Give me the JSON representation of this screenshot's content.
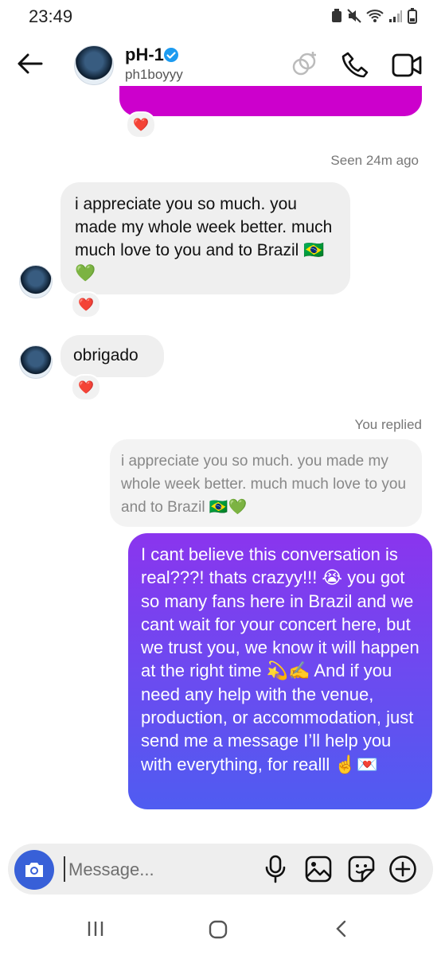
{
  "status_bar": {
    "time": "23:49"
  },
  "header": {
    "name": "pH-1",
    "handle": "ph1boyyy"
  },
  "thread": {
    "seen_label": "Seen 24m ago",
    "reaction_emoji": "❤️",
    "incoming": [
      {
        "text": "i appreciate you so much. you made my whole week better. much much love to you and to Brazil 🇧🇷💚",
        "reaction": "❤️"
      },
      {
        "text": "obrigado",
        "reaction": "❤️"
      }
    ],
    "replied_label": "You replied",
    "quoted_text": "i appreciate you so much. you made my whole week better. much much love to you and to Brazil 🇧🇷💚",
    "outgoing_text": "I cant believe this conversation is real???! thats crazyy!!! 😭 you got so many fans here in Brazil and we cant wait for your concert here, but we trust you, we know it will happen at the right time 💫✍️ And if you need any help with the venue, production, or accommodation, just send me a message I’ll help you with everything, for realll ☝️💌"
  },
  "composer": {
    "placeholder": "Message..."
  },
  "colors": {
    "outgoing_gradient_top": "#8a35ee",
    "outgoing_gradient_bottom": "#4f5cf1",
    "camera_button": "#3860d8",
    "previous_bubble": "#cc00cc",
    "verified_badge": "#1d9bf0"
  },
  "icons": [
    "back-arrow-icon",
    "verified-badge-icon",
    "effects-icon",
    "phone-icon",
    "video-camera-icon",
    "camera-icon",
    "microphone-icon",
    "gallery-icon",
    "sticker-icon",
    "plus-circle-icon",
    "recents-icon",
    "home-icon",
    "nav-back-icon"
  ]
}
